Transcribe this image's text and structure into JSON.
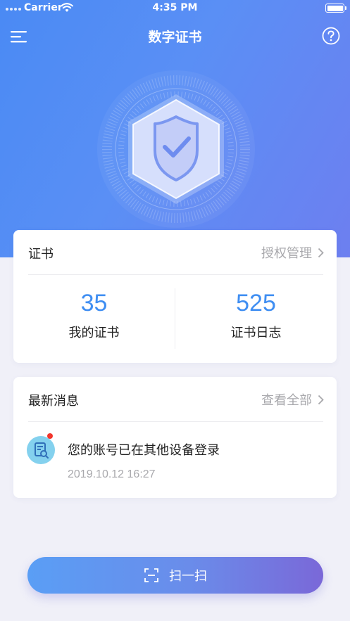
{
  "status_bar": {
    "carrier": "Carrier",
    "time": "4:35 PM"
  },
  "nav": {
    "title": "数字证书"
  },
  "cert_card": {
    "title": "证书",
    "link_label": "授权管理",
    "stats": [
      {
        "value": "35",
        "label": "我的证书"
      },
      {
        "value": "525",
        "label": "证书日志"
      }
    ]
  },
  "message_card": {
    "title": "最新消息",
    "link_label": "查看全部",
    "items": [
      {
        "text": "您的账号已在其他设备登录",
        "time": "2019.10.12 16:27",
        "unread": true
      }
    ]
  },
  "scan_button": {
    "label": "扫一扫"
  },
  "colors": {
    "primary": "#3f8ef2",
    "gradient_start": "#4a8af4",
    "gradient_end": "#7a68d8",
    "unread_dot": "#f2352c"
  },
  "icons": [
    "menu-icon",
    "help-icon",
    "shield-check-icon",
    "chevron-right-icon",
    "message-doc-icon",
    "scan-icon",
    "wifi-icon",
    "battery-icon"
  ]
}
